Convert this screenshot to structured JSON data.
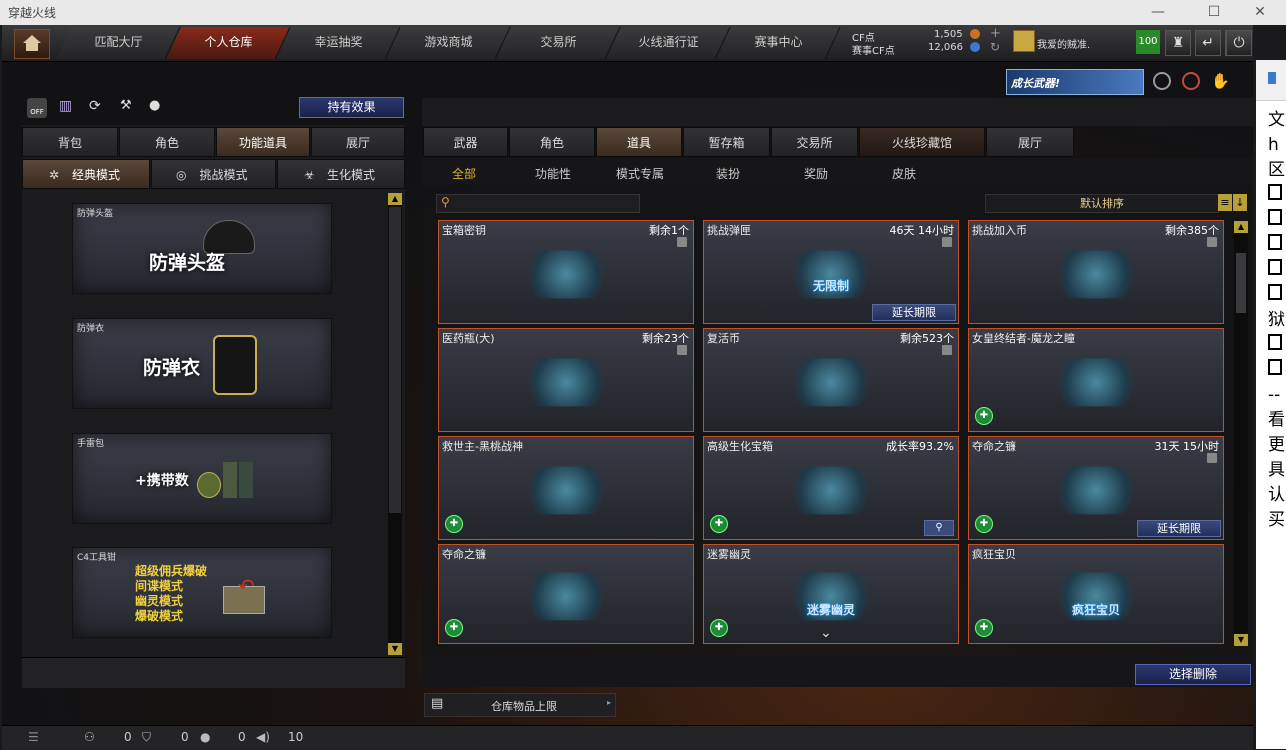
{
  "window": {
    "title": "穿越火线"
  },
  "nav": {
    "tabs": [
      "匹配大厅",
      "个人仓库",
      "幸运抽奖",
      "游戏商城",
      "交易所",
      "火线通行证",
      "赛事中心"
    ],
    "active_tab": "个人仓库",
    "cf_label": "CF点",
    "cf_value": "1,505",
    "event_cf_label": "赛事CF点",
    "event_cf_value": "12,066",
    "tribe_label": "我爱的贼准.",
    "level": "100"
  },
  "banner": {
    "text": "成长武器!"
  },
  "left": {
    "own_effect_button": "持有效果",
    "tabs": [
      "背包",
      "角色",
      "功能道具",
      "展厅"
    ],
    "active_tab": "功能道具",
    "mode_tabs": [
      "经典模式",
      "挑战模式",
      "生化模式"
    ],
    "active_mode": "经典模式",
    "cards": [
      {
        "name": "防弹头盔",
        "caption": "防弹头盔"
      },
      {
        "name": "防弹衣",
        "caption": "防弹衣"
      },
      {
        "name": "手雷包",
        "caption": "+携带数"
      },
      {
        "name": "C4工具钳",
        "caption_lines": [
          "超级佣兵爆破",
          "间谍模式",
          "幽灵模式",
          "爆破模式"
        ]
      }
    ]
  },
  "right": {
    "tabs": [
      "武器",
      "角色",
      "道具",
      "暂存箱",
      "交易所",
      "火线珍藏馆",
      "展厅"
    ],
    "active_tab": "道具",
    "subtabs": [
      "全部",
      "功能性",
      "模式专属",
      "装扮",
      "奖励",
      "皮肤"
    ],
    "active_subtab": "全部",
    "search_placeholder": "",
    "sort_label": "默认排序",
    "delete_button": "选择删除",
    "storage_limit": "仓库物品上限",
    "items": [
      {
        "name": "宝箱密钥",
        "count": "剩余1个",
        "lock": true
      },
      {
        "name": "挑战弹匣",
        "count": "46天 14小时",
        "lock": true,
        "extend": "延长期限",
        "art_text": "无限制"
      },
      {
        "name": "挑战加入币",
        "count": "剩余385个",
        "lock": true
      },
      {
        "name": "医药瓶(大)",
        "count": "剩余23个",
        "lock": true
      },
      {
        "name": "复活币",
        "count": "剩余523个",
        "lock": true
      },
      {
        "name": "女皇终结者-魔龙之瞳",
        "count": "",
        "badge": true
      },
      {
        "name": "救世主-黑桃战神",
        "count": "",
        "badge": true
      },
      {
        "name": "高级生化宝箱",
        "count": "成长率93.2%",
        "badge": true,
        "search": true
      },
      {
        "name": "夺命之镰",
        "count": "31天 15小时",
        "lock": true,
        "badge": true,
        "extend": "延长期限"
      },
      {
        "name": "夺命之镰",
        "count": "",
        "badge": true
      },
      {
        "name": "迷雾幽灵",
        "count": "",
        "badge": true,
        "art_text": "迷雾幽灵"
      },
      {
        "name": "疯狂宝贝",
        "count": "",
        "badge": true,
        "art_text": "疯狂宝贝"
      }
    ]
  },
  "status": {
    "v1": "0",
    "v2": "0",
    "v3": "0",
    "v4": "10"
  },
  "side_panel": {
    "lines": [
      "文",
      "h",
      "区",
      "",
      "",
      "",
      "",
      "",
      "狱",
      "",
      "",
      "--",
      "看",
      "更",
      "具",
      "认",
      "买"
    ]
  }
}
